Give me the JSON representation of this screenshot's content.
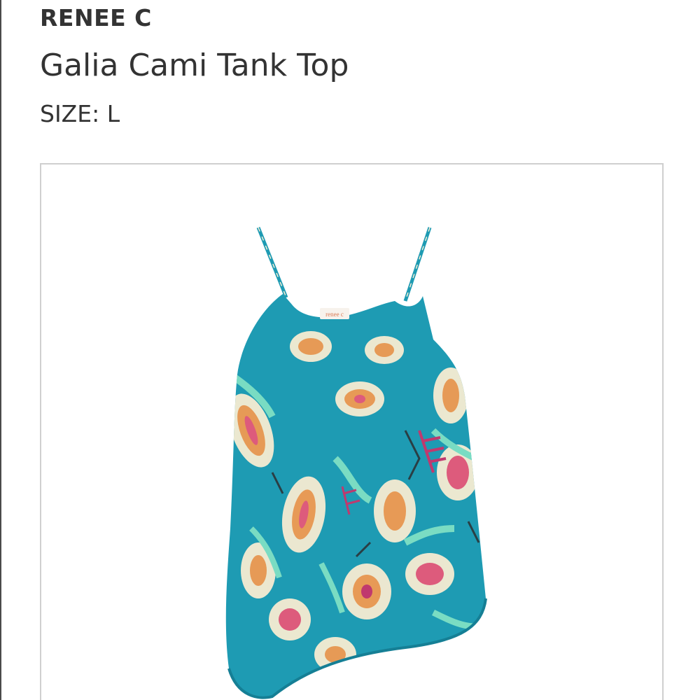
{
  "product": {
    "brand": "RENEE C",
    "name": "Galia Cami Tank Top",
    "size_label": "SIZE:",
    "size_value": "L"
  },
  "image": {
    "tag_text": "renee c",
    "colors": {
      "base": "#1e9bb3",
      "base_dark": "#157f95",
      "mint": "#7fe0c4",
      "cream": "#f7ecd2",
      "orange": "#f29a52",
      "pink": "#e8587a",
      "magenta": "#c9346b",
      "dark": "#2b3a3f"
    }
  }
}
